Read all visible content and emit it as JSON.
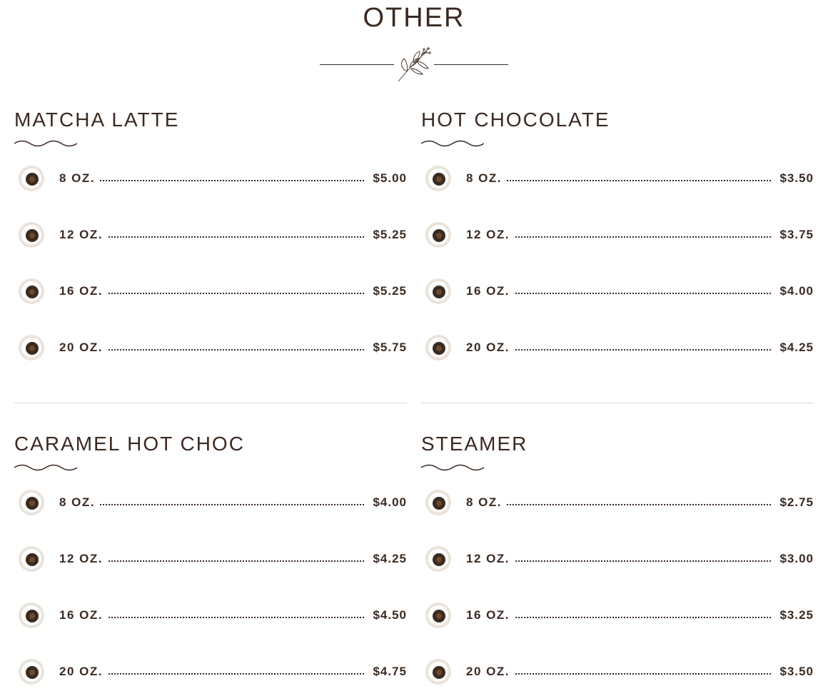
{
  "page": {
    "title": "OTHER"
  },
  "sections": [
    {
      "title": "MATCHA LATTE",
      "items": [
        {
          "size": "8 OZ.",
          "price": "$5.00"
        },
        {
          "size": "12 OZ.",
          "price": "$5.25"
        },
        {
          "size": "16 OZ.",
          "price": "$5.25"
        },
        {
          "size": "20 OZ.",
          "price": "$5.75"
        }
      ]
    },
    {
      "title": "HOT CHOCOLATE",
      "items": [
        {
          "size": "8 OZ.",
          "price": "$3.50"
        },
        {
          "size": "12 OZ.",
          "price": "$3.75"
        },
        {
          "size": "16 OZ.",
          "price": "$4.00"
        },
        {
          "size": "20 OZ.",
          "price": "$4.25"
        }
      ]
    },
    {
      "title": "CARAMEL HOT CHOC",
      "items": [
        {
          "size": "8 OZ.",
          "price": "$4.00"
        },
        {
          "size": "12 OZ.",
          "price": "$4.25"
        },
        {
          "size": "16 OZ.",
          "price": "$4.50"
        },
        {
          "size": "20 OZ.",
          "price": "$4.75"
        }
      ]
    },
    {
      "title": "STEAMER",
      "items": [
        {
          "size": "8 OZ.",
          "price": "$2.75"
        },
        {
          "size": "12 OZ.",
          "price": "$3.00"
        },
        {
          "size": "16 OZ.",
          "price": "$3.25"
        },
        {
          "size": "20 OZ.",
          "price": "$3.50"
        }
      ]
    }
  ],
  "icons": {
    "divider": "leaf-sprig-icon",
    "item": "coffee-cup-icon",
    "underline": "wave-underline-icon"
  },
  "colors": {
    "text": "#3a2a22",
    "separator": "#d9d9d9",
    "background": "#ffffff"
  }
}
